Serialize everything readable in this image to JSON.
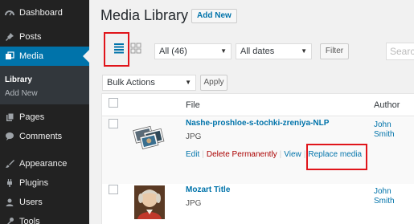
{
  "sidebar": {
    "items": [
      {
        "label": "Dashboard",
        "icon": "dashboard-icon"
      },
      {
        "label": "Posts",
        "icon": "pin-icon"
      },
      {
        "label": "Media",
        "icon": "media-icon",
        "active": true
      },
      {
        "label": "Pages",
        "icon": "pages-icon"
      },
      {
        "label": "Comments",
        "icon": "comments-icon"
      },
      {
        "label": "Appearance",
        "icon": "paintbrush-icon"
      },
      {
        "label": "Plugins",
        "icon": "plugin-icon"
      },
      {
        "label": "Users",
        "icon": "users-icon"
      },
      {
        "label": "Tools",
        "icon": "tools-icon"
      }
    ],
    "submenu": [
      {
        "label": "Library",
        "current": true
      },
      {
        "label": "Add New"
      }
    ]
  },
  "header": {
    "title": "Media Library",
    "add_new_label": "Add New"
  },
  "toolbar": {
    "view_list": "list-view-icon",
    "view_grid": "grid-view-icon",
    "type_filter": "All (46)",
    "date_filter": "All dates",
    "filter_button": "Filter",
    "search_placeholder": "Search",
    "bulk_actions": "Bulk Actions",
    "apply_button": "Apply"
  },
  "table": {
    "columns": {
      "file": "File",
      "author": "Author"
    },
    "rows": [
      {
        "title": "Nashe-proshloe-s-tochki-zreniya-NLP",
        "type": "JPG",
        "author_first": "John",
        "author_last": "Smith",
        "actions": {
          "edit": "Edit",
          "delete": "Delete Permanently",
          "view": "View",
          "replace": "Replace media"
        }
      },
      {
        "title": "Mozart Title",
        "type": "JPG",
        "author_first": "John",
        "author_last": "Smith"
      }
    ]
  },
  "colors": {
    "sidebar_bg": "#222222",
    "active_bg": "#0073aa",
    "link": "#0073aa",
    "highlight": "#e0151b",
    "delete": "#aa0000"
  }
}
